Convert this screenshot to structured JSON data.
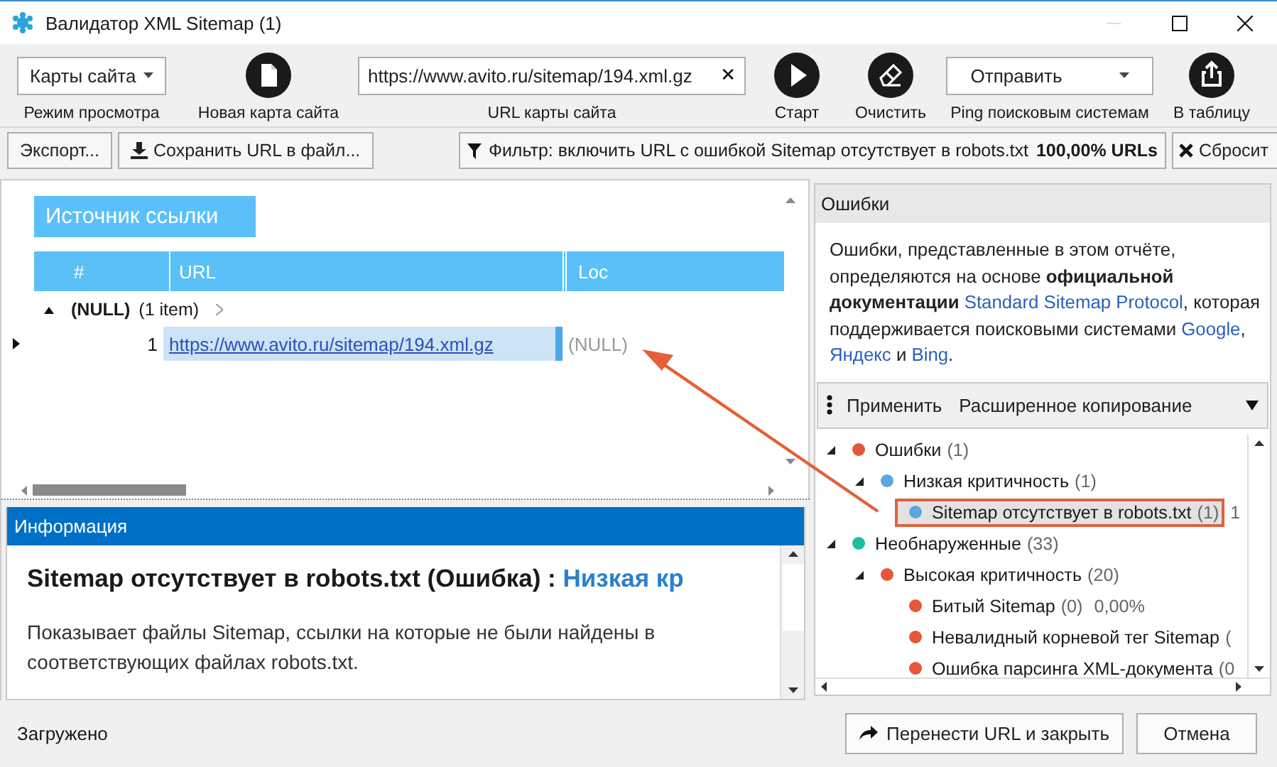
{
  "window": {
    "title": "Валидатор XML Sitemap (1)"
  },
  "toolbar": [
    {
      "kind": "dropdown",
      "value": "Карты сайта",
      "caption": "Режим просмотра"
    },
    {
      "kind": "button",
      "caption": "Новая карта сайта"
    },
    {
      "kind": "url",
      "value": "https://www.avito.ru/sitemap/194.xml.gz",
      "clear": "✕",
      "caption": "URL карты сайта"
    },
    {
      "kind": "button",
      "caption": "Старт"
    },
    {
      "kind": "button",
      "caption": "Очистить"
    },
    {
      "kind": "dropdown",
      "value": "Отправить",
      "caption": "Ping поисковым системам"
    },
    {
      "kind": "button",
      "caption": "В таблицу"
    }
  ],
  "actions": [
    {
      "label": "Экспорт..."
    },
    {
      "label": "Сохранить URL в файл..."
    }
  ],
  "filter": {
    "text": "Фильтр: включить URL с ошибкой Sitemap отсутствует в robots.txt",
    "share": "100,00% URLs"
  },
  "reset": {
    "label": "Сбросит"
  },
  "grid": {
    "group_by": "Источник ссылки",
    "columns": [
      "#",
      "URL",
      "Loc"
    ],
    "groups": [
      {
        "name": "(NULL)",
        "count": "(1 item)",
        "expanded": true,
        "rows": [
          {
            "number": "1",
            "url": "https://www.avito.ru/sitemap/194.xml.gz",
            "loc": "(NULL)",
            "selected": true
          }
        ]
      }
    ]
  },
  "info": {
    "title": "Информация",
    "heading": "Sitemap отсутствует в robots.txt (Ошибка) :",
    "severity": "Низкая кр",
    "text": "Показывает файлы Sitemap, ссылки на которые не были найдены в соответствующих файлах robots.txt."
  },
  "errors": {
    "title": "Ошибки",
    "description": [
      {
        "kind": "text",
        "text": "Ошибки, представленные в этом отчёте, определяются на основе **официальной документации** "
      },
      {
        "kind": "link",
        "text": "Standard Sitemap Protocol"
      },
      {
        "kind": "text",
        "text": ", которая поддерживается поисковыми системами "
      },
      {
        "kind": "link",
        "text": "Google"
      },
      {
        "kind": "text",
        "text": ", "
      },
      {
        "kind": "link",
        "text": "Яндекс"
      },
      {
        "kind": "text",
        "text": " и "
      },
      {
        "kind": "link",
        "text": "Bing"
      },
      {
        "kind": "text",
        "text": "."
      }
    ],
    "tools": [
      "Применить",
      "Расширенное копирование"
    ],
    "tree": [
      {
        "label": "Ошибки",
        "count": "(1)",
        "color": "#e8553a",
        "expanded": true,
        "selected": false,
        "highlighted": false,
        "children": [
          {
            "label": "Низкая критичность",
            "count": "(1)",
            "color": "#5aa6e0",
            "expanded": true,
            "selected": false,
            "highlighted": false,
            "children": [
              {
                "label": "Sitemap отсутствует в robots.txt",
                "count": "(1)",
                "extra": "1",
                "color": "#5aa6e0",
                "selected": true,
                "highlighted": true
              }
            ]
          }
        ]
      },
      {
        "label": "Необнаруженные",
        "count": "(33)",
        "color": "#1fbf9b",
        "expanded": true,
        "selected": false,
        "highlighted": false,
        "children": [
          {
            "label": "Высокая критичность",
            "count": "(20)",
            "color": "#e8553a",
            "expanded": true,
            "selected": false,
            "highlighted": false,
            "children": [
              {
                "label": "Битый Sitemap",
                "count": "(0)",
                "extra": "0,00%",
                "color": "#e8553a",
                "selected": false,
                "highlighted": false
              },
              {
                "label": "Невалидный корневой тег Sitemap",
                "count": "(",
                "color": "#e8553a",
                "selected": false,
                "highlighted": false
              },
              {
                "label": "Ошибка парсинга XML-документа",
                "count": "(0",
                "color": "#e8553a",
                "selected": false,
                "highlighted": false
              }
            ]
          }
        ]
      }
    ]
  },
  "status": {
    "text": "Загружено",
    "buttons": [
      {
        "label": "Перенести URL и закрыть"
      },
      {
        "label": "Отмена"
      }
    ]
  }
}
